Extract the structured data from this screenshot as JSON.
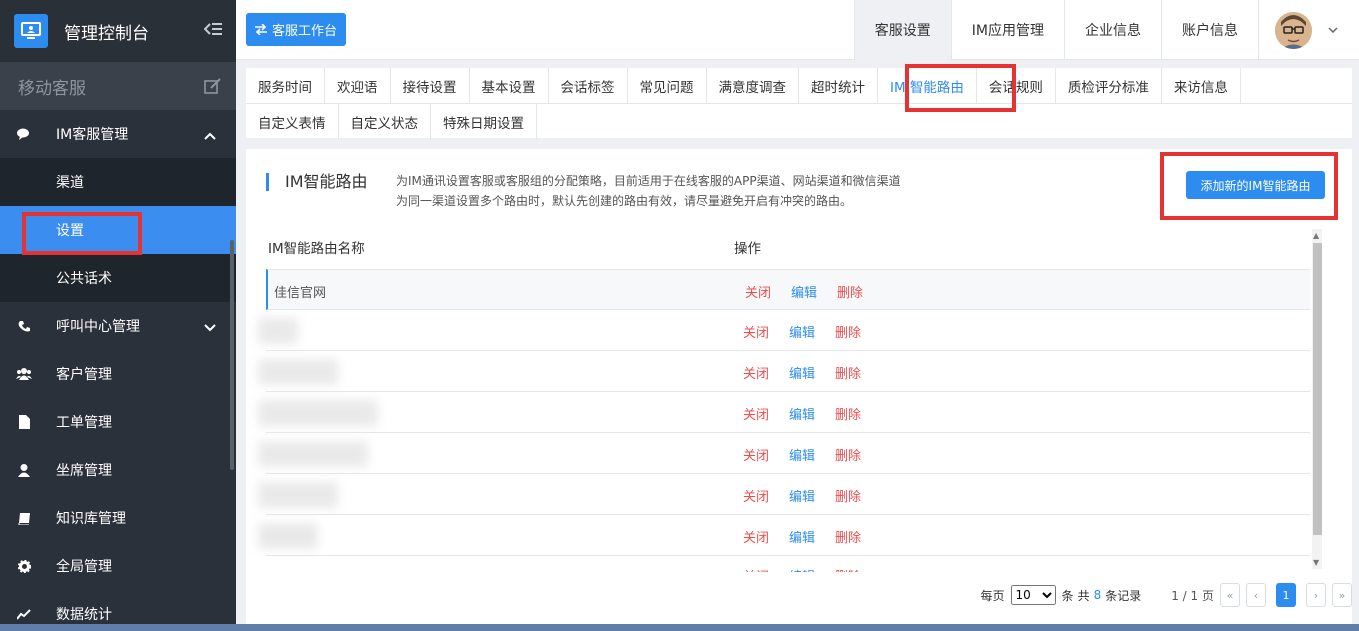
{
  "app": {
    "title": "管理控制台"
  },
  "colors": {
    "accent": "#2d8cf0",
    "sidebar_bg": "#2a313b",
    "danger": "#ed4d4d",
    "highlight_box": "#e53333"
  },
  "sidebar": {
    "section_label": "移动客服",
    "menu": [
      {
        "label": "IM客服管理",
        "icon": "chat-icon",
        "expanded": true,
        "children": [
          {
            "label": "渠道"
          },
          {
            "label": "设置",
            "active": true
          },
          {
            "label": "公共话术"
          }
        ]
      },
      {
        "label": "呼叫中心管理",
        "icon": "phone-icon"
      },
      {
        "label": "客户管理",
        "icon": "users-icon"
      },
      {
        "label": "工单管理",
        "icon": "file-icon"
      },
      {
        "label": "坐席管理",
        "icon": "user-icon"
      },
      {
        "label": "知识库管理",
        "icon": "book-icon"
      },
      {
        "label": "全局管理",
        "icon": "gear-icon"
      },
      {
        "label": "数据统计",
        "icon": "chart-icon"
      }
    ]
  },
  "topbar": {
    "workspace_button": "客服工作台",
    "nav": [
      {
        "label": "客服设置",
        "active": true
      },
      {
        "label": "IM应用管理"
      },
      {
        "label": "企业信息"
      },
      {
        "label": "账户信息"
      }
    ]
  },
  "tabs": {
    "row1": [
      "服务时间",
      "欢迎语",
      "接待设置",
      "基本设置",
      "会话标签",
      "常见问题",
      "满意度调查",
      "超时统计",
      "IM 智能路由",
      "会话规则",
      "质检评分标准",
      "来访信息"
    ],
    "row2": [
      "自定义表情",
      "自定义状态",
      "特殊日期设置"
    ],
    "active": "IM 智能路由"
  },
  "panel": {
    "title": "IM智能路由",
    "desc_line1": "为IM通讯设置客服或客服组的分配策略，目前适用于在线客服的APP渠道、网站渠道和微信渠道",
    "desc_line2": "为同一渠道设置多个路由时，默认先创建的路由有效，请尽量避免开启有冲突的路由。",
    "add_button": "添加新的IM智能路由",
    "col_name": "IM智能路由名称",
    "col_action": "操作",
    "first_row_name": "佳信官网",
    "action_close": "关闭",
    "action_edit": "编辑",
    "action_delete": "删除"
  },
  "pager": {
    "per_page_label": "每页",
    "per_page_value": "10",
    "unit": "条",
    "total_prefix": "共",
    "total": "8",
    "total_suffix": "条记录",
    "page_info": "1 / 1 页",
    "current_page": "1"
  }
}
